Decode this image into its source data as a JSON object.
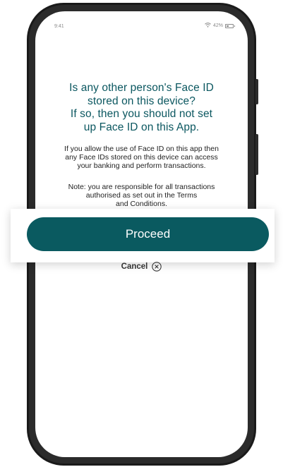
{
  "status_bar": {
    "time": "9:41",
    "battery_percent": "42%",
    "battery_level": 0.42,
    "icons": [
      "wifi-icon",
      "battery-icon"
    ]
  },
  "dialog": {
    "headline_lines": [
      "Is any other person's Face ID",
      "stored on this device?",
      "If so, then you should not set",
      "up Face ID on this App."
    ],
    "paragraph1_lines": [
      "If you allow the use of Face ID on this app then",
      "any Face IDs stored on this device can access",
      "your banking and perform transactions."
    ],
    "paragraph2_lines": [
      "Note: you are responsible for all transactions",
      "authorised as set out in the Terms",
      "and Conditions."
    ]
  },
  "actions": {
    "proceed_label": "Proceed",
    "cancel_label": "Cancel",
    "cancel_icon": "close-circle-icon"
  },
  "colors": {
    "brand_teal": "#0a5a60",
    "headline_teal": "#0b5760"
  }
}
